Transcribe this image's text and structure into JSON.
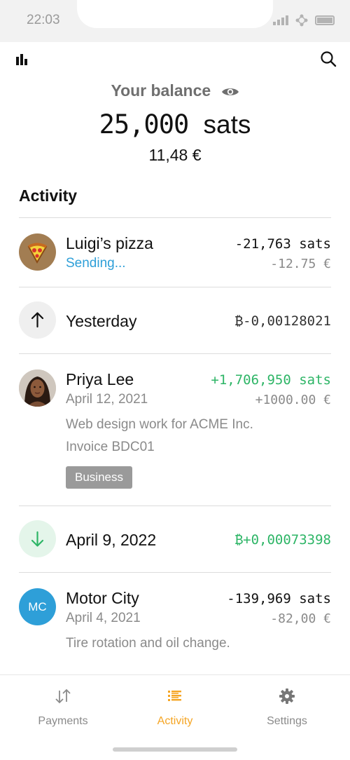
{
  "status": {
    "time": "22:03"
  },
  "header": {
    "chart_icon": "bar-chart-icon",
    "search_icon": "search-icon"
  },
  "balance": {
    "label": "Your balance",
    "amount": "25,000",
    "unit": "sats",
    "fiat": "11,48 €"
  },
  "activity": {
    "title": "Activity",
    "items": [
      {
        "name": "Luigi’s pizza",
        "status": "Sending...",
        "amount": "-21,763 sats",
        "fiat": "-12.75 €"
      },
      {
        "name": "Yesterday",
        "amount": "₿-0,00128021"
      },
      {
        "name": "Priya Lee",
        "date": "April 12, 2021",
        "amount": "+1,706,950 sats",
        "fiat": "+1000.00 €",
        "note_line1": "Web design work for ACME Inc.",
        "note_line2": "Invoice BDC01",
        "tag": "Business"
      },
      {
        "name": "April 9, 2022",
        "amount": "₿+0,00073398"
      },
      {
        "name": "Motor City",
        "initials": "MC",
        "date": "April 4, 2021",
        "amount": "-139,969 sats",
        "fiat": "-82,00 €",
        "note": "Tire rotation and oil change."
      }
    ]
  },
  "nav": {
    "payments": "Payments",
    "activity": "Activity",
    "settings": "Settings"
  },
  "colors": {
    "accent": "#f5a524",
    "positive": "#2db566",
    "link": "#2e9fd8",
    "avatar_mc": "#2e9fd8",
    "tag_bg": "#9a9a9a"
  }
}
